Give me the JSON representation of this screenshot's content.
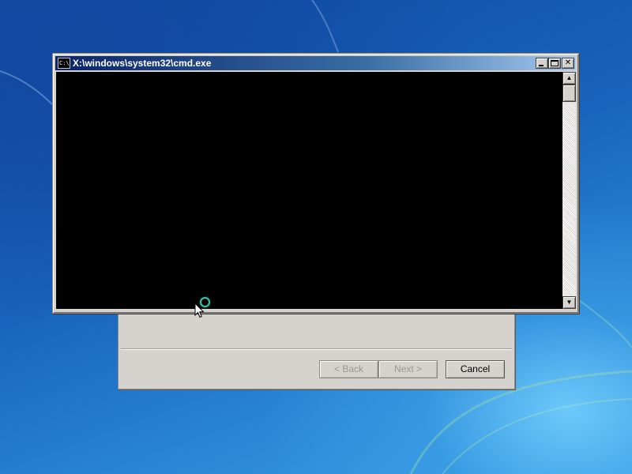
{
  "desktop": {
    "accent": "#1b5fb0"
  },
  "cmd_window": {
    "title": "X:\\windows\\system32\\cmd.exe",
    "icon": "cmd-icon",
    "icon_text": "C:\\",
    "minimize_icon": "minimize-icon",
    "maximize_icon": "maximize-icon",
    "close_symbol": "✕",
    "console_bg": "#000000",
    "scroll_up_symbol": "▲",
    "scroll_down_symbol": "▼",
    "titlebar_color": "#0a246a"
  },
  "setup_dialog": {
    "back_label": "< Back",
    "next_label": "Next >",
    "cancel_label": "Cancel",
    "face_color": "#d6d3ce"
  },
  "cursor": {
    "icon": "arrow-cursor-icon",
    "busy_indicator": "busy-ring-icon",
    "busy_color": "#35c6b0"
  }
}
